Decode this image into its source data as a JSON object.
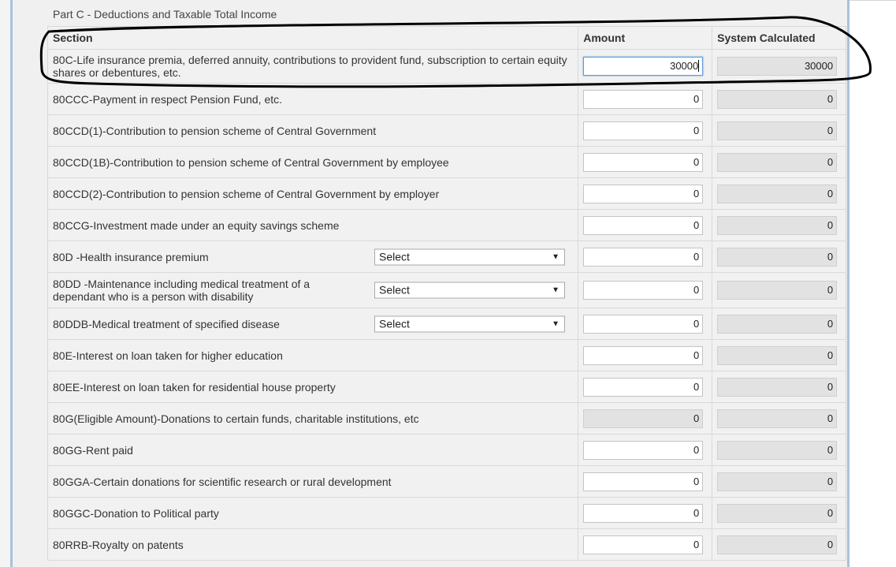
{
  "part_title": "Part C - Deductions and Taxable Total Income",
  "headers": {
    "section": "Section",
    "amount": "Amount",
    "system_calculated": "System Calculated"
  },
  "rows": [
    {
      "section": "80C-Life insurance premia, deferred annuity, contributions to provident fund, subscription to certain equity shares or debentures, etc.",
      "amount": "30000",
      "system": "30000"
    },
    {
      "section": "80CCC-Payment in respect Pension Fund, etc.",
      "amount": "0",
      "system": "0"
    },
    {
      "section": "80CCD(1)-Contribution to pension scheme of Central Government",
      "amount": "0",
      "system": "0"
    },
    {
      "section": "80CCD(1B)-Contribution to pension scheme of Central Government by employee",
      "amount": "0",
      "system": "0"
    },
    {
      "section": "80CCD(2)-Contribution to pension scheme of Central Government by employer",
      "amount": "0",
      "system": "0"
    },
    {
      "section": "80CCG-Investment made under an equity savings scheme",
      "amount": "0",
      "system": "0"
    },
    {
      "section": "80D -Health insurance premium",
      "select": "Select",
      "amount": "0",
      "system": "0"
    },
    {
      "section": "80DD -Maintenance including medical treatment of a dependant who is a person with disability",
      "select": "Select",
      "amount": "0",
      "system": "0"
    },
    {
      "section": "80DDB-Medical treatment of specified disease",
      "select": "Select",
      "amount": "0",
      "system": "0"
    },
    {
      "section": "80E-Interest on loan taken for higher education",
      "amount": "0",
      "system": "0"
    },
    {
      "section": "80EE-Interest on loan taken for residential house property",
      "amount": "0",
      "system": "0"
    },
    {
      "section": "80G(Eligible Amount)-Donations to certain funds, charitable institutions, etc",
      "amount": "0",
      "system": "0"
    },
    {
      "section": "80GG-Rent paid",
      "amount": "0",
      "system": "0"
    },
    {
      "section": "80GGA-Certain donations for scientific research or rural development",
      "amount": "0",
      "system": "0"
    },
    {
      "section": "80GGC-Donation to Political party",
      "amount": "0",
      "system": "0"
    },
    {
      "section": "80RRB-Royalty on patents",
      "amount": "0",
      "system": "0"
    }
  ],
  "icons": {
    "dropdown": "chevron-down-icon"
  },
  "colors": {
    "background": "#f0f0f0",
    "frame_border": "#a9c1dc",
    "focus_border": "#5b9dd9",
    "disabled_input": "#e2e2e2",
    "annotation_stroke": "#000000"
  }
}
